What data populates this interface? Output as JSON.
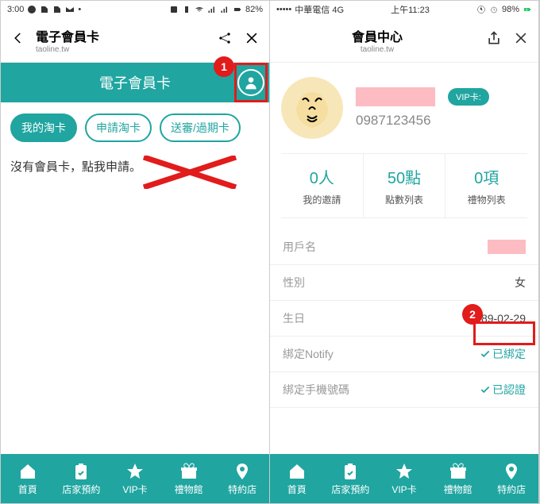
{
  "left": {
    "status": {
      "time": "3:00",
      "battery": "82%"
    },
    "header": {
      "title": "電子會員卡",
      "sub": "taoline.tw"
    },
    "teal_title": "電子會員卡",
    "pills": {
      "mine": "我的淘卡",
      "apply": "申請淘卡",
      "review": "送審/過期卡"
    },
    "empty": "沒有會員卡，點我申請。",
    "annotation1": "1"
  },
  "right": {
    "status": {
      "carrier": "中華電信  4G",
      "time": "上午11:23",
      "battery": "98%"
    },
    "header": {
      "title": "會員中心",
      "sub": "taoline.tw"
    },
    "vip_label": "VIP卡:",
    "phone": "0987123456",
    "stats": {
      "invite": {
        "val": "0人",
        "lbl": "我的邀請"
      },
      "points": {
        "val": "50點",
        "lbl": "點數列表"
      },
      "gifts": {
        "val": "0項",
        "lbl": "禮物列表"
      }
    },
    "rows": {
      "username_lbl": "用戶名",
      "gender_lbl": "性別",
      "gender_val": "女",
      "bday_lbl": "生日",
      "bday_val": "1989-02-29",
      "notify_lbl": "綁定Notify",
      "notify_val": "已綁定",
      "phonebind_lbl": "綁定手機號碼",
      "phonebind_val": "已認證"
    },
    "annotation2": "2"
  },
  "nav": {
    "home": "首頁",
    "booking": "店家預約",
    "vip": "VIP卡",
    "gift": "禮物館",
    "shop": "特約店"
  }
}
